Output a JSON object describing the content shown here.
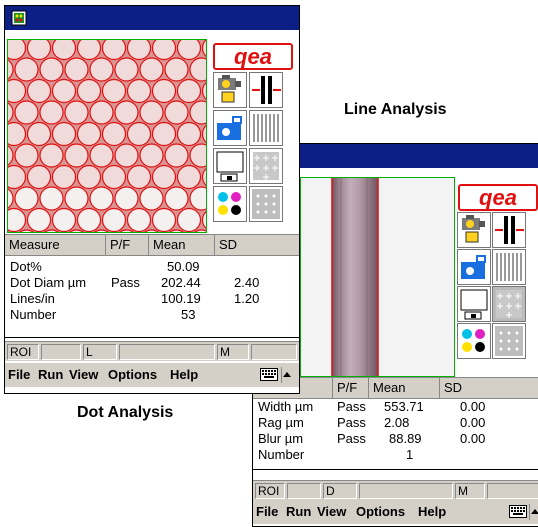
{
  "captions": {
    "line_analysis": "Line Analysis",
    "dot_analysis": "Dot Analysis"
  },
  "logo_text": "qea",
  "colors": {
    "titlebar": "#0c1f86",
    "accent": "#e01010",
    "panel": "#d4d0c8"
  },
  "dot_window": {
    "table": {
      "columns": [
        "Measure",
        "P/F",
        "Mean",
        "SD"
      ],
      "rows": [
        {
          "measure": "Dot%",
          "pf": "",
          "mean": "50.09",
          "sd": ""
        },
        {
          "measure": "Dot Diam µm",
          "pf": "Pass",
          "mean": "202.44",
          "sd": "2.40"
        },
        {
          "measure": "Lines/in",
          "pf": "",
          "mean": "100.19",
          "sd": "1.20"
        },
        {
          "measure": "Number",
          "pf": "",
          "mean": "53",
          "sd": ""
        }
      ]
    },
    "status": {
      "cell1": "ROI",
      "cell2": "",
      "cell3": "L",
      "cell4": "",
      "cell5": "M",
      "cell6": ""
    },
    "menu": [
      "File",
      "Run",
      "View",
      "Options",
      "Help"
    ]
  },
  "line_window": {
    "table": {
      "columns": [
        "ure",
        "P/F",
        "Mean",
        "SD"
      ],
      "rows": [
        {
          "measure": "Width µm",
          "pf": "Pass",
          "mean": "553.71",
          "sd": "0.00"
        },
        {
          "measure": "Rag µm",
          "pf": "Pass",
          "mean": "2.08",
          "sd": "0.00"
        },
        {
          "measure": "Blur µm",
          "pf": "Pass",
          "mean": "88.89",
          "sd": "0.00"
        },
        {
          "measure": "Number",
          "pf": "",
          "mean": "1",
          "sd": ""
        }
      ]
    },
    "status": {
      "cell1": "ROI",
      "cell2": "",
      "cell3": "D",
      "cell4": "",
      "cell5": "M",
      "cell6": ""
    },
    "menu": [
      "File",
      "Run",
      "View",
      "Options",
      "Help"
    ]
  },
  "icons": {
    "app": "traffic-light-icon",
    "camera": "camera-icon",
    "line_tool": "line-arrows-icon",
    "snapshot": "snapshot-camera-icon",
    "vertical_lines": "vertical-lines-icon",
    "print": "print-page-icon",
    "dot_grid_plus": "dot-grid-plus-icon",
    "cmyk": "cmyk-dots-icon",
    "dot_grid": "dot-grid-icon",
    "keyboard": "keyboard-icon",
    "up_arrow": "up-arrow-icon"
  }
}
